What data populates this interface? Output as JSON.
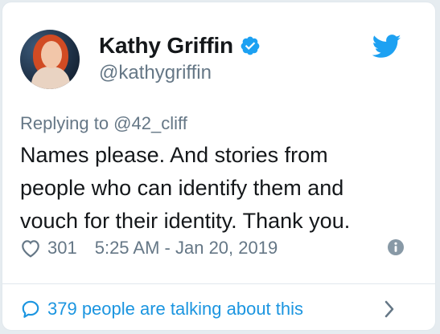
{
  "author": {
    "display_name": "Kathy Griffin",
    "handle": "@kathygriffin",
    "verified": true
  },
  "tweet": {
    "replying_to": "Replying to @42_cliff",
    "text": "Names please. And stories from people who can identify them and vouch for their identity. Thank you.",
    "likes": "301",
    "timestamp": "5:25 AM - Jan 20, 2019"
  },
  "footer": {
    "talking_label": "379 people are talking about this"
  },
  "icons": {
    "verified": "verified-badge-icon",
    "twitter": "twitter-bird-icon",
    "like": "heart-icon",
    "info": "info-icon",
    "comment": "comment-bubble-icon",
    "chevron": "chevron-right-icon"
  },
  "colors": {
    "twitter_blue": "#1da1f2",
    "link_blue": "#1b95e0",
    "secondary_text": "#657786",
    "primary_text": "#14171a"
  }
}
